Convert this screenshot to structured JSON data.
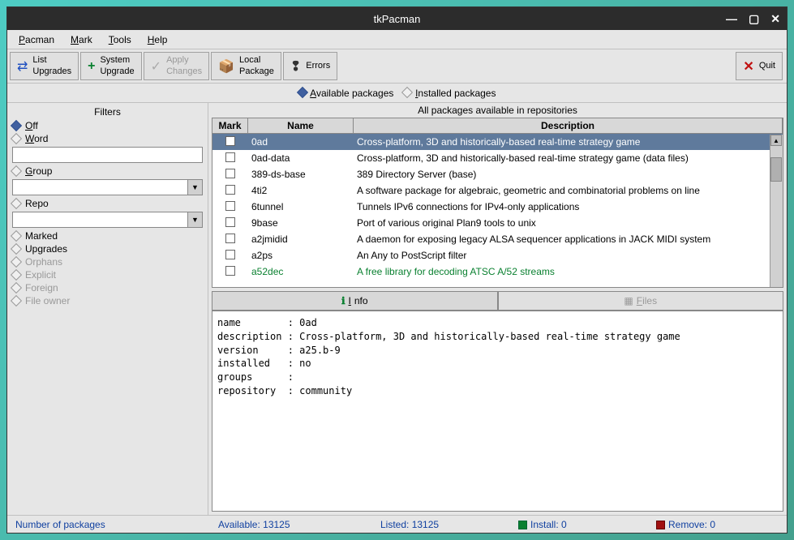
{
  "window": {
    "title": "tkPacman"
  },
  "menubar": [
    {
      "label": "Pacman",
      "key": "P"
    },
    {
      "label": "Mark",
      "key": "M"
    },
    {
      "label": "Tools",
      "key": "T"
    },
    {
      "label": "Help",
      "key": "H"
    }
  ],
  "toolbar": {
    "list_upgrades": "List\nUpgrades",
    "system_upgrade": "System\nUpgrade",
    "apply_changes": "Apply\nChanges",
    "local_package": "Local\nPackage",
    "errors": "Errors",
    "quit": "Quit"
  },
  "viewbar": {
    "available": "Available packages",
    "installed": "Installed packages"
  },
  "sidebar": {
    "title": "Filters",
    "items": {
      "off": "Off",
      "word": "Word",
      "group": "Group",
      "repo": "Repo",
      "marked": "Marked",
      "upgrades": "Upgrades",
      "orphans": "Orphans",
      "explicit": "Explicit",
      "foreign": "Foreign",
      "file_owner": "File owner"
    },
    "word_value": "",
    "group_value": "",
    "repo_value": ""
  },
  "main": {
    "title": "All packages available in repositories",
    "columns": {
      "mark": "Mark",
      "name": "Name",
      "description": "Description"
    },
    "packages": [
      {
        "name": "0ad",
        "desc": "Cross-platform, 3D and historically-based real-time strategy game",
        "selected": true
      },
      {
        "name": "0ad-data",
        "desc": "Cross-platform, 3D and historically-based real-time strategy game (data files)"
      },
      {
        "name": "389-ds-base",
        "desc": "389 Directory Server (base)"
      },
      {
        "name": "4ti2",
        "desc": "A software package for algebraic, geometric and combinatorial problems on line"
      },
      {
        "name": "6tunnel",
        "desc": "Tunnels IPv6 connections for IPv4-only applications"
      },
      {
        "name": "9base",
        "desc": "Port of various original Plan9 tools to unix"
      },
      {
        "name": "a2jmidid",
        "desc": "A daemon for exposing legacy ALSA sequencer applications in JACK MIDI system"
      },
      {
        "name": "a2ps",
        "desc": "An Any to PostScript filter"
      },
      {
        "name": "a52dec",
        "desc": "A free library for decoding ATSC A/52 streams",
        "installed": true
      }
    ],
    "tabs": {
      "info": "Info",
      "files": "Files"
    },
    "info_text": "name        : 0ad\ndescription : Cross-platform, 3D and historically-based real-time strategy game\nversion     : a25.b-9\ninstalled   : no\ngroups      :\nrepository  : community"
  },
  "statusbar": {
    "label": "Number of packages",
    "available": "Available: 13125",
    "listed": "Listed: 13125",
    "install": "Install: 0",
    "remove": "Remove: 0"
  }
}
